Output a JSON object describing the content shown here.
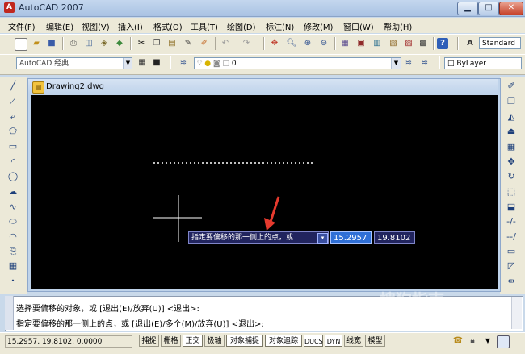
{
  "window": {
    "title": "AutoCAD 2007",
    "app_icon": "A",
    "minimize_icon": "minimize-icon",
    "maximize_icon": "maximize-icon",
    "close_icon": "close-icon"
  },
  "menu": [
    "文件(F)",
    "编辑(E)",
    "视图(V)",
    "插入(I)",
    "格式(O)",
    "工具(T)",
    "绘图(D)",
    "标注(N)",
    "修改(M)",
    "窗口(W)",
    "帮助(H)"
  ],
  "toolbar": {
    "text_style": "Standard",
    "workspace": "AutoCAD 经典",
    "layer": "0",
    "linetype": "ByLayer"
  },
  "drawing": {
    "tab_title": "Drawing2.dwg"
  },
  "dynamic_input": {
    "prompt": "指定要偏移的那一侧上的点，或",
    "x_value": "15.2957",
    "y_value": "19.8102"
  },
  "command_line": {
    "line1": "选择要偏移的对象，或 [退出(E)/放弃(U)] <退出>:",
    "line2": "指定要偏移的那一侧上的点，或 [退出(E)/多个(M)/放弃(U)] <退出>:"
  },
  "status": {
    "coordinates": "15.2957, 19.8102, 0.0000",
    "toggles": [
      "捕捉",
      "栅格",
      "正交",
      "极轴",
      "对象捕捉",
      "对象追踪",
      "DUCS",
      "DYN",
      "线宽",
      "模型"
    ]
  },
  "watermark": "搜狗指南",
  "colors": {
    "canvas": "#000000",
    "crosshair": "#ffffff",
    "arrow": "#e63a2e",
    "dyn_input_bg": "#21245e",
    "dyn_input_active": "#2f6fd6"
  }
}
